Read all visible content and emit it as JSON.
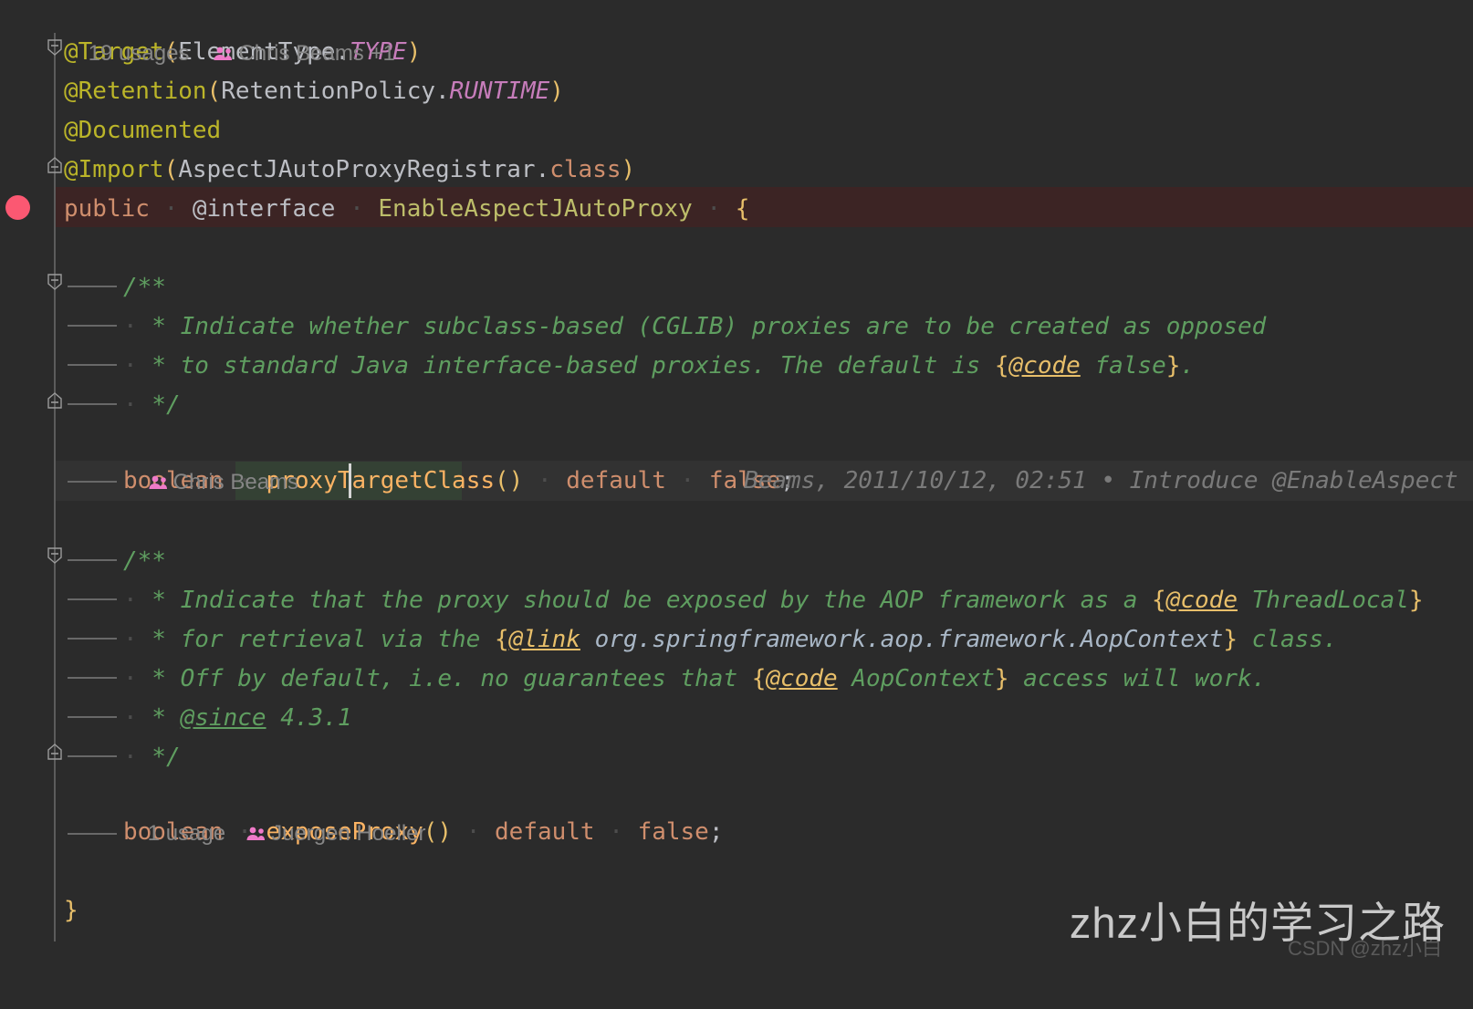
{
  "editor": {
    "background": "#2b2b2b",
    "breakpoint_line_bg": "#3c2424",
    "caret_line_bg": "#323232",
    "identifier_highlight_bg": "#344134",
    "breakpoint_color": "#fb5872"
  },
  "inlays": {
    "class_usages": "19 usages",
    "class_author": "Chris Beams +1",
    "proxy_target_class_author": "Chris Beams",
    "expose_proxy_usages": "1 usage",
    "expose_proxy_author": "Juergen Hoeller"
  },
  "blame": {
    "proxy_target_class": "Beams, 2011/10/12, 02:51 • Introduce @EnableAspect"
  },
  "code": {
    "l1_target": {
      "anno": "@Target",
      "open": "(",
      "cls": "ElementType",
      "dot": ".",
      "stat": "TYPE",
      "close": ")"
    },
    "l2_retention": {
      "anno": "@Retention",
      "open": "(",
      "cls": "RetentionPolicy",
      "dot": ".",
      "stat": "RUNTIME",
      "close": ")"
    },
    "l3_documented": {
      "anno": "@Documented"
    },
    "l4_import": {
      "anno": "@Import",
      "open": "(",
      "cls": "AspectJAutoProxyRegistrar",
      "dot": ".",
      "kw": "class",
      "close": ")"
    },
    "l5_decl": {
      "kw1": "public",
      "kw2": "@interface",
      "name": "EnableAspectJAutoProxy",
      "brace": "{"
    },
    "doc1": {
      "open": "/**",
      "line1_pre": " * Indicate whether subclass-based (CGLIB) proxies are to be created as opposed",
      "line2_pre": " * to standard Java interface-based proxies. The default is ",
      "line2_brace_open": "{",
      "line2_tag": "@code",
      "line2_val": " false",
      "line2_brace_close": "}",
      "line2_post": ".",
      "close": " */"
    },
    "m1": {
      "type": "boolean",
      "name": "proxyTargetClass",
      "parens": "()",
      "default_kw": "default",
      "value": "false",
      "semi": ";"
    },
    "doc2": {
      "open": "/**",
      "line1_pre": " * Indicate that the proxy should be exposed by the AOP framework as a ",
      "line1_brace_open": "{",
      "line1_tag": "@code",
      "line1_val": " ThreadLocal",
      "line1_brace_close": "}",
      "line2_pre": " * for retrieval via the ",
      "line2_brace_open": "{",
      "line2_tag": "@link",
      "line2_val": " org.springframework.aop.framework.AopContext",
      "line2_brace_close": "}",
      "line2_post": " class.",
      "line3_pre": " * Off by default, i.e. no guarantees that ",
      "line3_brace_open": "{",
      "line3_tag": "@code",
      "line3_val": " AopContext",
      "line3_brace_close": "}",
      "line3_post": " access will work.",
      "line4_pre": " * ",
      "line4_tag": "@since",
      "line4_post": " 4.3.1",
      "close": " */"
    },
    "m2": {
      "type": "boolean",
      "name": "exposeProxy",
      "parens": "()",
      "default_kw": "default",
      "value": "false",
      "semi": ";"
    },
    "close_brace": "}"
  },
  "watermark": {
    "main": "zhz小白的学习之路",
    "sub": "CSDN @zhz小白"
  }
}
